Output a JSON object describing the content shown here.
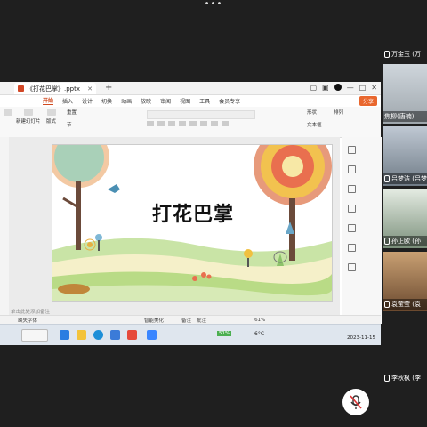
{
  "meeting": {
    "participants": [
      {
        "name": "万金玉 (万"
      },
      {
        "name": "焦柳(唐楠)"
      },
      {
        "name": "吕梦洁 (吕梦"
      },
      {
        "name": "孙正欧 (孙"
      },
      {
        "name": "袁莹莹 (袁"
      },
      {
        "name": "李秋枫 (李"
      }
    ]
  },
  "window": {
    "tab_title": "《打花巴掌》.pptx",
    "share_label": "分享"
  },
  "ribbon": {
    "tabs": [
      "开始",
      "插入",
      "设计",
      "切换",
      "动画",
      "放映",
      "审阅",
      "视图",
      "工具",
      "会员专享"
    ],
    "active_tab": "开始",
    "new_slide": "新建幻灯片",
    "layout": "版式",
    "reset": "重置",
    "section": "节",
    "shape": "形状",
    "arrange": "排列",
    "text_box": "文本框"
  },
  "slide": {
    "title": "打花巴掌",
    "notes_placeholder": "单击此处添加备注"
  },
  "statusbar": {
    "font_missing": "缺失字体",
    "smart_beautify": "智能美化",
    "notes_btn": "备注",
    "annotations": "批注",
    "zoom": "61%"
  },
  "taskbar": {
    "battery": "51%",
    "weather": "6°C",
    "date": "2023-11-15"
  }
}
